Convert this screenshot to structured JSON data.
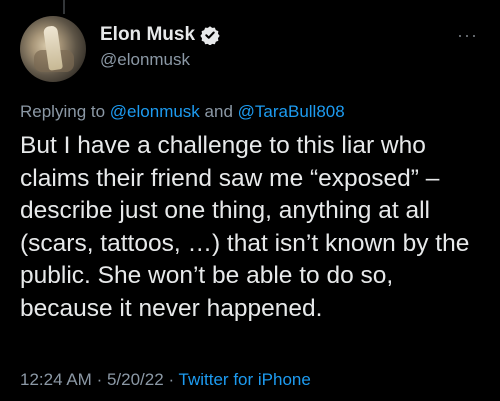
{
  "author": {
    "display_name": "Elon Musk",
    "handle": "@elonmusk",
    "verified": true
  },
  "reply": {
    "prefix": "Replying to",
    "mention1": "@elonmusk",
    "joiner": "and",
    "mention2": "@TaraBull808"
  },
  "tweet": {
    "text": "But I have a challenge to this liar who claims their friend saw me “exposed” – describe just one thing, anything at all (scars, tattoos, …) that isn’t known by the public. She won’t be able to do so, because it never happened."
  },
  "meta": {
    "time": "12:24 AM",
    "separator1": "·",
    "date": "5/20/22",
    "separator2": "·",
    "source": "Twitter for iPhone"
  },
  "colors": {
    "background": "#000000",
    "text": "#e7e9ea",
    "secondary": "#8b98a5",
    "link": "#1d9bf0"
  },
  "icons": {
    "verified": "verified-badge-icon",
    "more": "more-horizontal-icon"
  }
}
